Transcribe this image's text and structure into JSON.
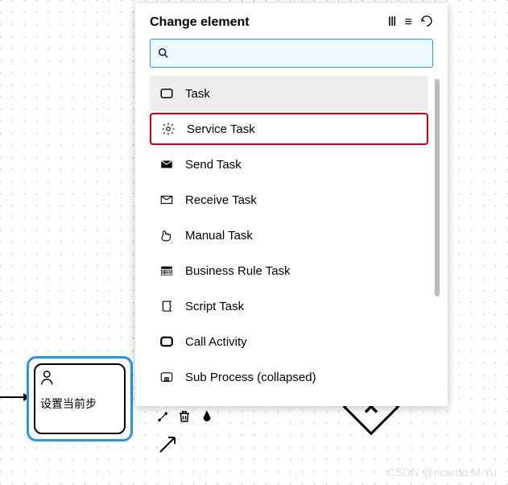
{
  "popup": {
    "title": "Change element",
    "search_placeholder": "",
    "items": [
      {
        "label": "Task",
        "icon": "task"
      },
      {
        "label": "Service Task",
        "icon": "gear"
      },
      {
        "label": "Send Task",
        "icon": "send"
      },
      {
        "label": "Receive Task",
        "icon": "receive"
      },
      {
        "label": "Manual Task",
        "icon": "hand"
      },
      {
        "label": "Business Rule Task",
        "icon": "table"
      },
      {
        "label": "Script Task",
        "icon": "script"
      },
      {
        "label": "Call Activity",
        "icon": "call"
      },
      {
        "label": "Sub Process (collapsed)",
        "icon": "subprocess"
      }
    ]
  },
  "node": {
    "label": "设置当前步"
  },
  "watermark": "CSDN @ricardo.M.Yu"
}
